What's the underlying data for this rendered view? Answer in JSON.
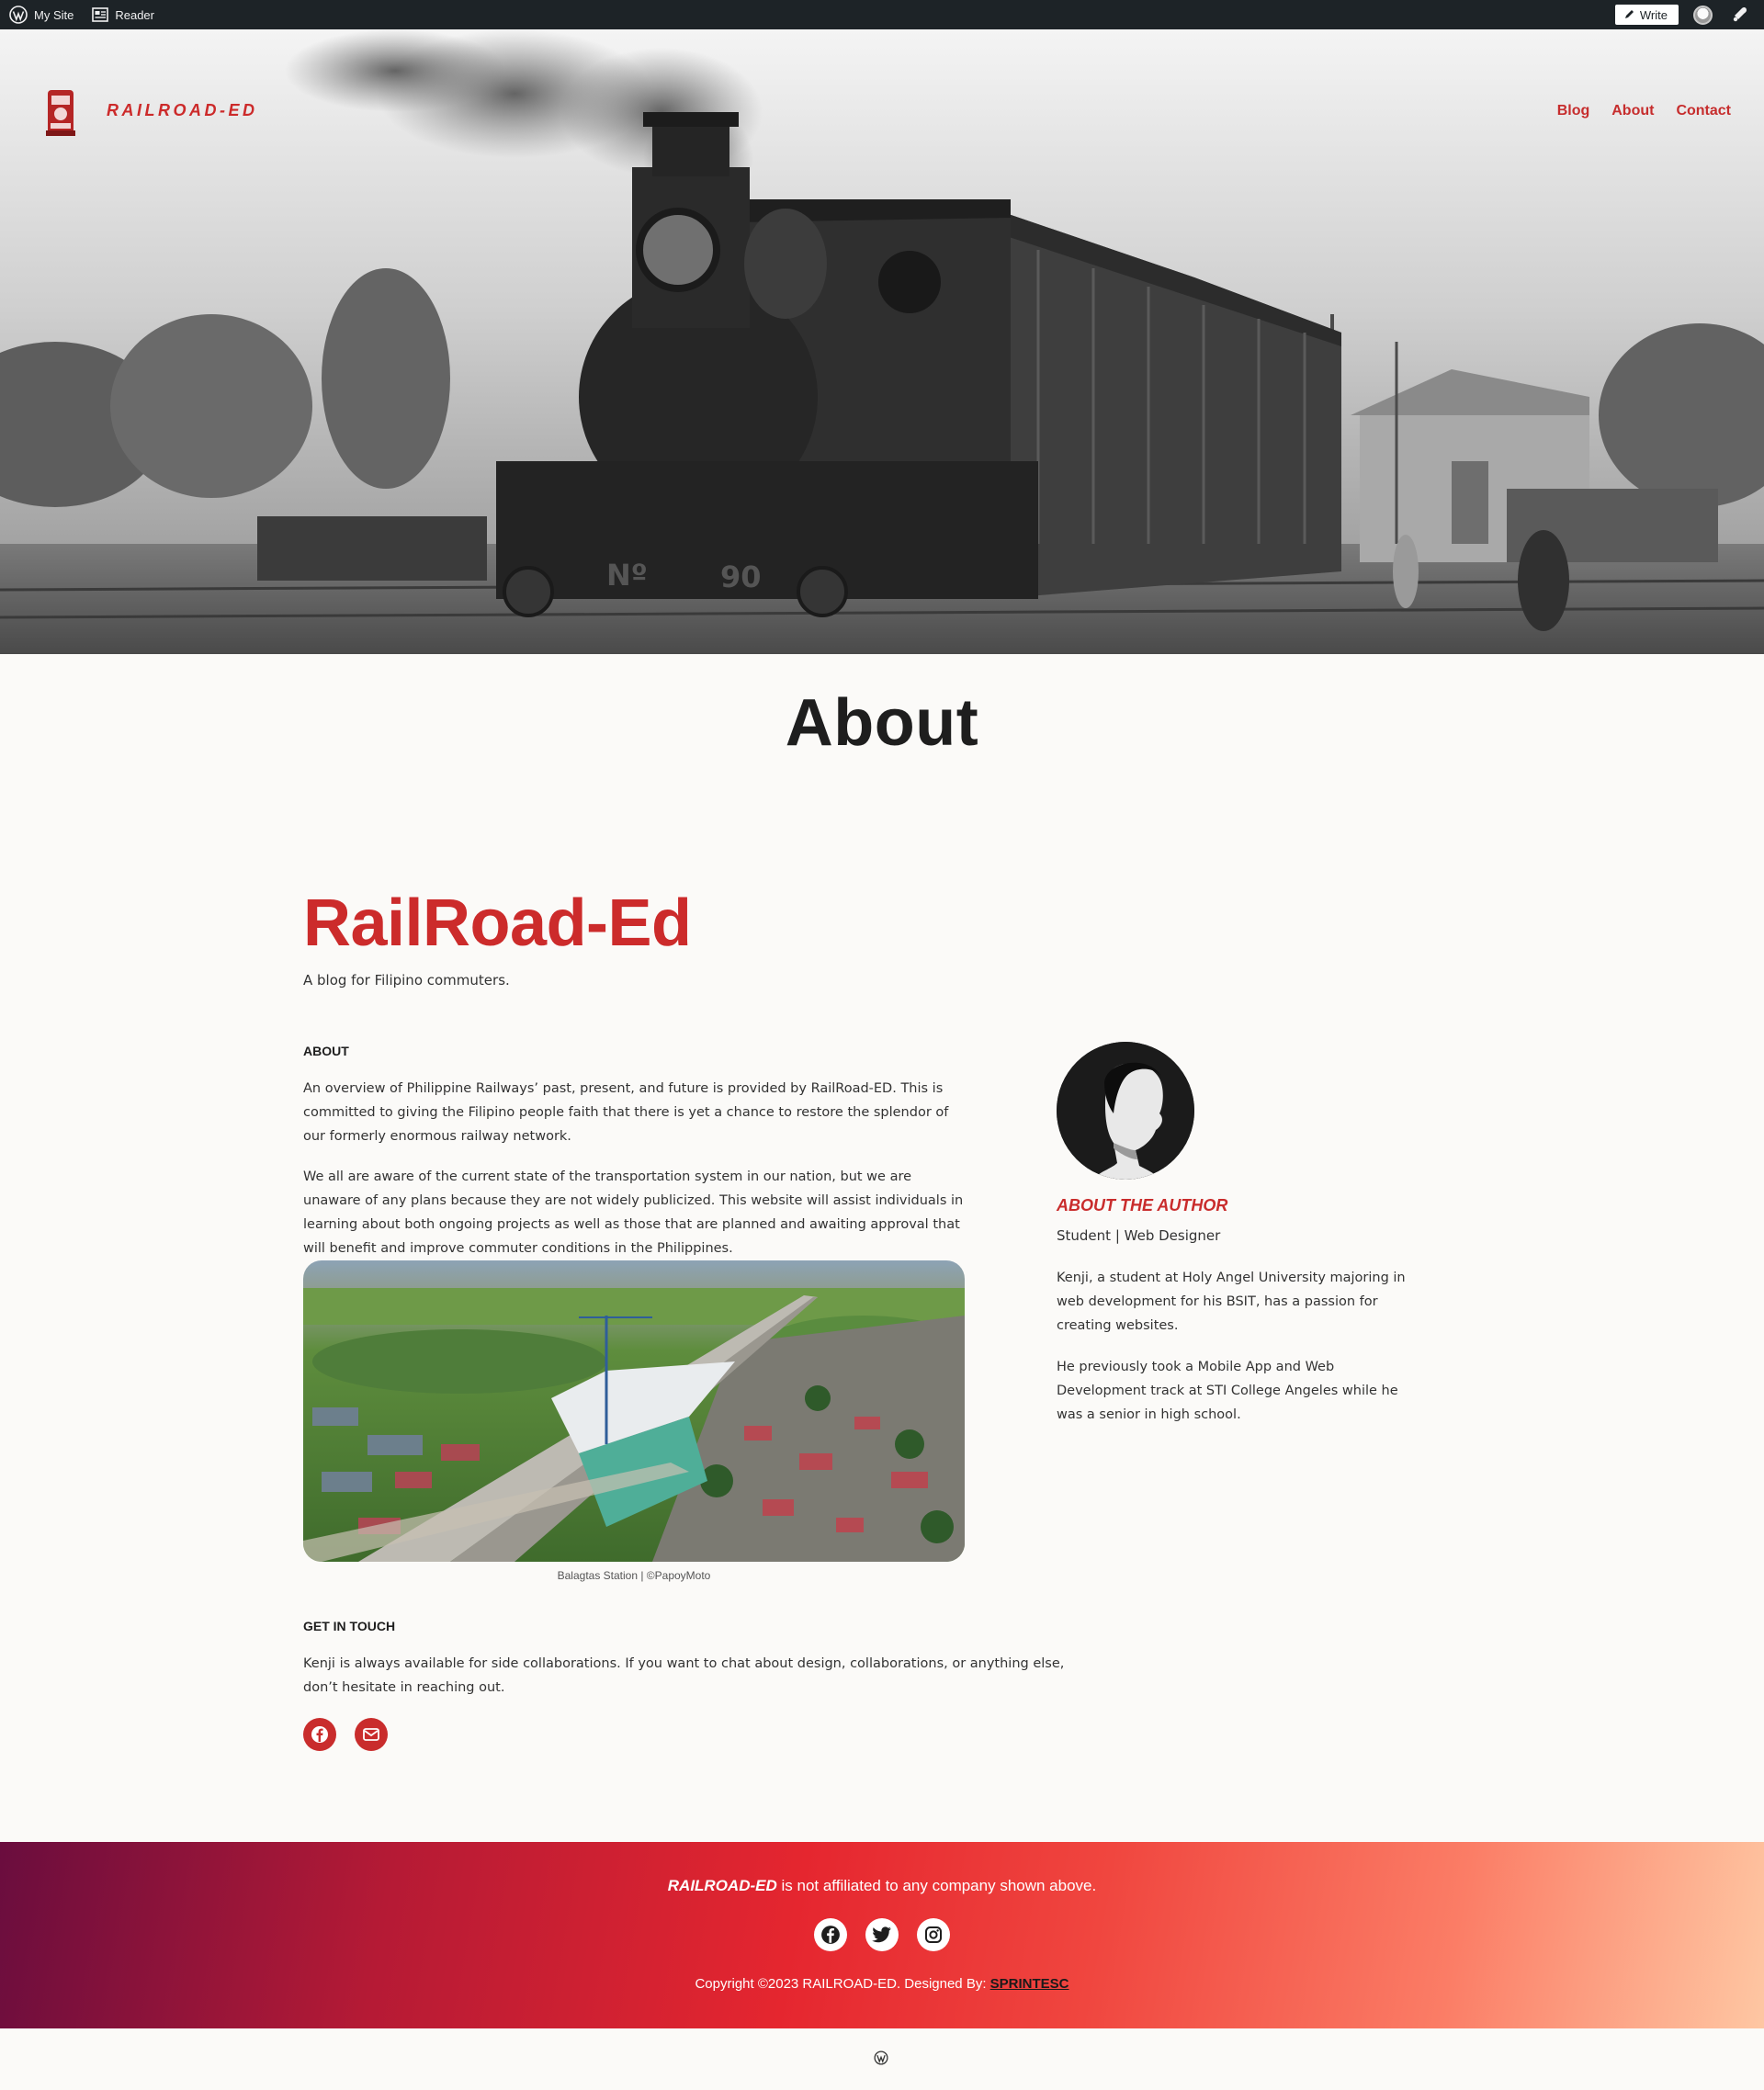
{
  "admin_bar": {
    "my_site": "My Site",
    "reader": "Reader",
    "write": "Write"
  },
  "header": {
    "site_title": "RAILROAD-ED",
    "nav": [
      "Blog",
      "About",
      "Contact"
    ]
  },
  "page": {
    "title": "About"
  },
  "content": {
    "heading": "RailRoad-Ed",
    "tagline": "A blog for Filipino commuters.",
    "about_label": "ABOUT",
    "about_paragraphs": [
      "An overview of Philippine Railways’ past, present, and future is provided by RailRoad-ED. This is committed to giving the Filipino people faith that there is yet a chance to restore the splendor of our formerly enormous railway network.",
      "We all are aware of the current state of the transportation system in our nation, but we are unaware of any plans because they are not widely publicized. This website will assist individuals in learning about both ongoing projects as well as those that are planned and awaiting approval that will benefit and improve commuter conditions in the Philippines."
    ],
    "image_caption": "Balagtas Station | ©PapoyMoto",
    "contact_label": "GET IN TOUCH",
    "contact_text": "Kenji is always available for side collaborations. If you want to chat about design, collaborations, or anything else, don’t hesitate in reaching out."
  },
  "author": {
    "heading": "ABOUT THE AUTHOR",
    "role": "Student | Web Designer",
    "paragraphs": [
      "Kenji, a student at Holy Angel University majoring in web development for his BSIT, has a passion for creating websites.",
      "He previously took a Mobile App and Web Development track at STI College Angeles while he was a senior in high school."
    ]
  },
  "footer": {
    "brand": "RAILROAD-ED",
    "disclaimer_rest": " is not affiliated to any company shown above.",
    "copyright": "Copyright ©2023 RAILROAD-ED. Designed By: ",
    "designer": "SPRINTESC"
  },
  "icons": {
    "contact": [
      "facebook-icon",
      "mail-icon"
    ],
    "social": [
      "facebook-icon",
      "twitter-icon",
      "instagram-icon"
    ]
  },
  "colors": {
    "accent": "#c92c2c",
    "admin_bar": "#1d2327",
    "background": "#fbfaf8"
  }
}
